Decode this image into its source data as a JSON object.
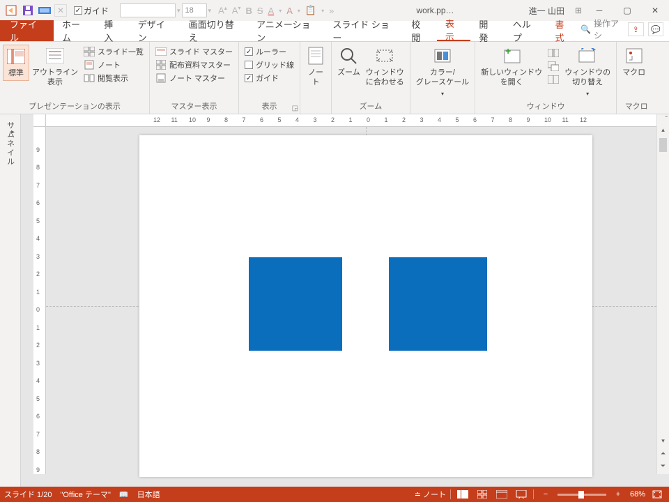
{
  "qat": {
    "guide_label": "ガイド"
  },
  "font": {
    "name": "",
    "size": "18"
  },
  "title": {
    "doc": "work.pp…",
    "user": "進一 山田"
  },
  "tabs": {
    "file": "ファイル",
    "items": [
      "ホーム",
      "挿入",
      "デザイン",
      "画面切り替え",
      "アニメーション",
      "スライド ショー",
      "校閲",
      "表示",
      "開発",
      "ヘルプ"
    ],
    "context": "書式",
    "active_index": 7,
    "search": "操作アシ"
  },
  "ribbon": {
    "presentation_views": {
      "label": "プレゼンテーションの表示",
      "normal": "標準",
      "outline": "アウトライン\n表示",
      "sorter": "スライド一覧",
      "notes_page": "ノート",
      "reading": "閲覧表示"
    },
    "master_views": {
      "label": "マスター表示",
      "slide_master": "スライド マスター",
      "handout_master": "配布資料マスター",
      "notes_master": "ノート マスター"
    },
    "show": {
      "label": "表示",
      "ruler": "ルーラー",
      "gridlines": "グリッド線",
      "guides": "ガイド"
    },
    "notes_btn": "ノー\nト",
    "zoom": {
      "label": "ズーム",
      "zoom": "ズーム",
      "fit": "ウィンドウ\nに合わせる"
    },
    "color": {
      "label": "",
      "btn": "カラー/\nグレースケール"
    },
    "window": {
      "label": "ウィンドウ",
      "new": "新しいウィンドウ\nを開く",
      "switch": "ウィンドウの\n切り替え"
    },
    "macros": {
      "label": "マクロ",
      "btn": "マクロ"
    }
  },
  "thumbnail_tab": "サムネイル",
  "h_ruler": [
    "12",
    "11",
    "10",
    "9",
    "8",
    "7",
    "6",
    "5",
    "4",
    "3",
    "2",
    "1",
    "0",
    "1",
    "2",
    "3",
    "4",
    "5",
    "6",
    "7",
    "8",
    "9",
    "10",
    "11",
    "12"
  ],
  "v_ruler": [
    "9",
    "8",
    "7",
    "6",
    "5",
    "4",
    "3",
    "2",
    "1",
    "0",
    "1",
    "2",
    "3",
    "4",
    "5",
    "6",
    "7",
    "8",
    "9"
  ],
  "status": {
    "slide": "スライド 1/20",
    "theme": "\"Office テーマ\"",
    "lang": "日本語",
    "notes": "ノート",
    "zoom": "68%"
  }
}
